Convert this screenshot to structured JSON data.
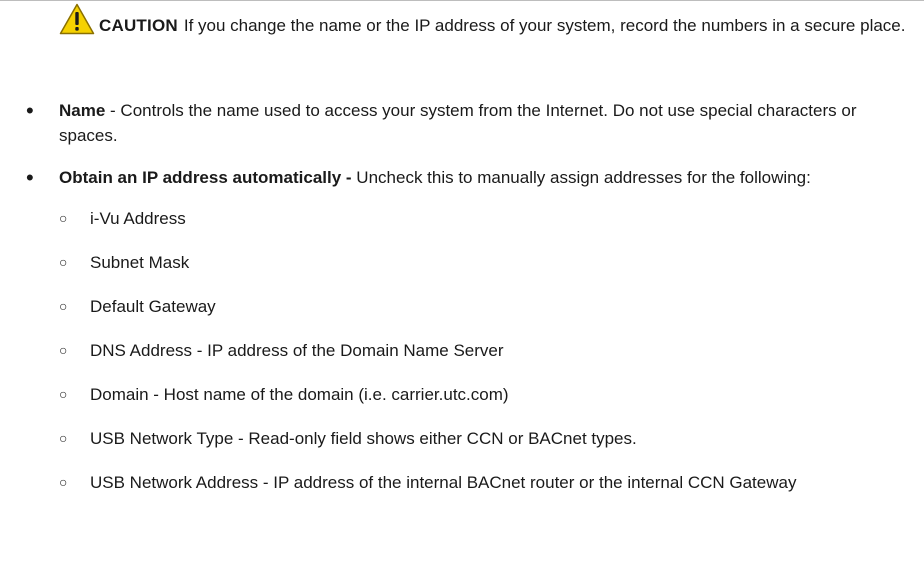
{
  "caution": {
    "label": "CAUTION",
    "text": "If you change the name or the IP address of your system, record the numbers in a secure place."
  },
  "bullets": [
    {
      "term": "Name",
      "separator": " - ",
      "text": "Controls the name used to access your system from the Internet. Do not use special characters or spaces."
    },
    {
      "term": "Obtain an IP address automatically -",
      "separator": " ",
      "text": "Uncheck this to manually assign addresses for the following:"
    }
  ],
  "sub_items": [
    "i-Vu Address",
    "Subnet Mask",
    "Default Gateway",
    "DNS Address - IP address of the Domain Name Server",
    "Domain - Host name of the domain (i.e. carrier.utc.com)",
    "USB Network Type - Read-only field shows either CCN or BACnet types.",
    "USB Network Address - IP address of the internal BACnet router or the internal CCN Gateway"
  ],
  "colors": {
    "warning_yellow": "#f5d100",
    "warning_border": "#8a7000",
    "text": "#1a1a1a"
  },
  "icons": {
    "caution": "warning-triangle-icon",
    "sub_bullet": "hollow-circle"
  }
}
